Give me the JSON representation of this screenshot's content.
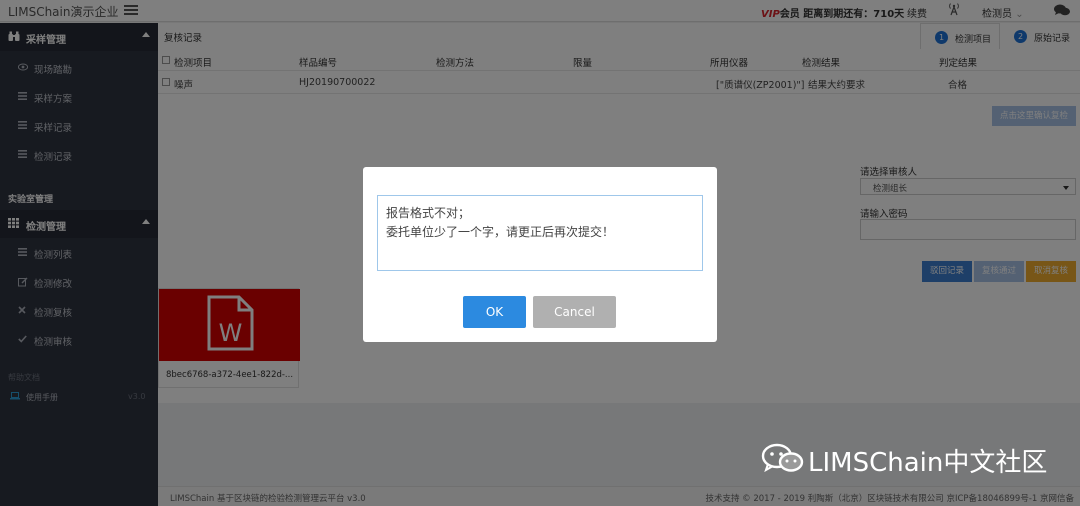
{
  "header": {
    "app_title": "LIMSChain演示企业",
    "vip_tag": "VIP",
    "vip_text": "会员 距离到期还有：710天",
    "renew": "续费",
    "user": "检测员",
    "user_chevron": "⌄"
  },
  "sidebar": {
    "section1": {
      "label": "采样管理",
      "icon": "binoculars-icon"
    },
    "section1_items": [
      {
        "label": "现场踏勘",
        "icon": "eye-icon"
      },
      {
        "label": "采样方案",
        "icon": "list-icon"
      },
      {
        "label": "采样记录",
        "icon": "list-icon"
      },
      {
        "label": "检测记录",
        "icon": "list-icon"
      }
    ],
    "lab_category": "实验室管理",
    "section2": {
      "label": "检测管理",
      "icon": "grid-icon"
    },
    "section2_items": [
      {
        "label": "检测列表",
        "icon": "list-icon"
      },
      {
        "label": "检测修改",
        "icon": "edit-icon"
      },
      {
        "label": "检测复核",
        "icon": "times-icon"
      },
      {
        "label": "检测审核",
        "icon": "check-icon"
      }
    ],
    "help_label": "帮助文档",
    "manual": {
      "label": "使用手册",
      "version": "v3.0"
    }
  },
  "main": {
    "title": "复核记录",
    "tabs": [
      {
        "num": "1",
        "label": "检测项目"
      },
      {
        "num": "2",
        "label": "原始记录"
      }
    ],
    "table": {
      "headers": [
        "检测项目",
        "样品编号",
        "检测方法",
        "限量",
        "所用仪器",
        "检测结果",
        "判定结果"
      ],
      "rows": [
        [
          "噪声",
          "HJ20190700022",
          "",
          "",
          "[\"质谱仪(ZP2001)\"]",
          "结果大约要求",
          "合格"
        ]
      ]
    },
    "confirm_button": "点击这里确认复检",
    "reviewer_label": "请选择审核人",
    "reviewer_value": "检测组长",
    "password_label": "请输入密码",
    "actions": {
      "reject": "驳回记录",
      "pass": "复核通过",
      "cancel": "取消复核"
    },
    "file_name": "8bec6768-a372-4ee1-822d-..."
  },
  "footer": {
    "left": "LIMSChain 基于区块链的检验检测管理云平台 v3.0",
    "right": "技术支持 © 2017 - 2019 利陶斯（北京）区块链技术有限公司 京ICP备18046899号-1 京网信备"
  },
  "modal": {
    "textarea_value": "报告格式不对；\n委托单位少了一个字，请更正后再次提交！",
    "ok": "OK",
    "cancel": "Cancel"
  },
  "watermark": "LIMSChain中文社区",
  "colors": {
    "sidebar_bg": "#2f3440",
    "primary": "#2c8ae0",
    "reject": "#3d7fd0",
    "pass": "#a9c3e6",
    "cancel_review": "#f0ad2e",
    "file_red": "#d40000",
    "vip_red": "#d9222a"
  }
}
